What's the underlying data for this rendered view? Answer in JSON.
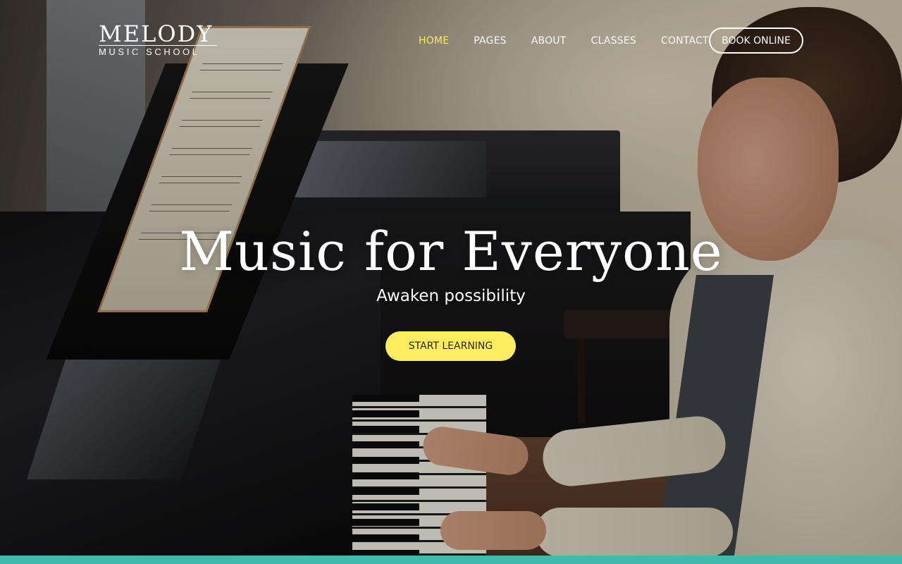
{
  "brand": {
    "name": "MELODY",
    "tagline": "MUSIC SCHOOL"
  },
  "nav": {
    "items": [
      {
        "label": "HOME",
        "active": true
      },
      {
        "label": "PAGES",
        "active": false
      },
      {
        "label": "ABOUT",
        "active": false
      },
      {
        "label": "CLASSES",
        "active": false
      },
      {
        "label": "CONTACT",
        "active": false
      }
    ],
    "book_label": "BOOK ONLINE"
  },
  "hero": {
    "title": "Music for Everyone",
    "subtitle": "Awaken possibility",
    "cta_label": "START LEARNING"
  },
  "colors": {
    "accent": "#fdec5e",
    "cta_background": "#fdec5e",
    "bottom_bar": "#45b8ac",
    "text": "#ffffff"
  }
}
